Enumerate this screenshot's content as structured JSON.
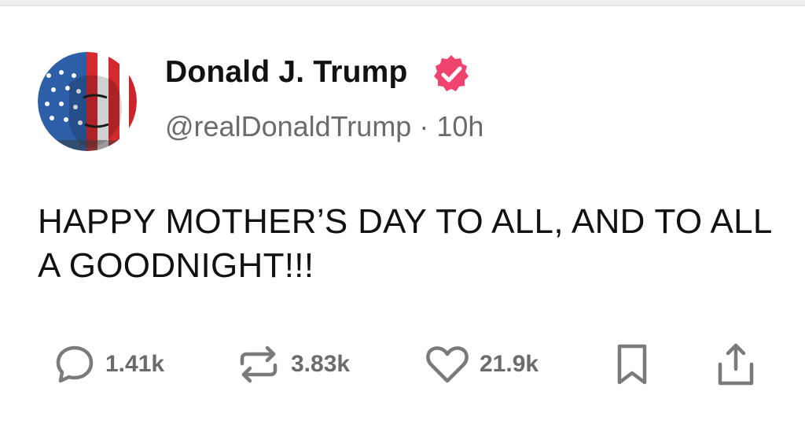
{
  "post": {
    "author": {
      "display_name": "Donald J. Trump",
      "handle": "@realDonaldTrump",
      "verified": true,
      "verified_color": "#f0436f"
    },
    "time_ago": "10h",
    "separator": "·",
    "text": "HAPPY MOTHER’S DAY TO ALL, AND TO ALL A GOODNIGHT!!!"
  },
  "actions": {
    "reply": {
      "icon": "comment-icon",
      "count": "1.41k"
    },
    "repost": {
      "icon": "repost-icon",
      "count": "3.83k"
    },
    "like": {
      "icon": "heart-icon",
      "count": "21.9k"
    },
    "bookmark": {
      "icon": "bookmark-icon"
    },
    "share": {
      "icon": "share-icon"
    }
  },
  "colors": {
    "text": "#111111",
    "muted": "#6b6b6b",
    "icon": "#7a7a7a",
    "badge": "#f0436f"
  }
}
